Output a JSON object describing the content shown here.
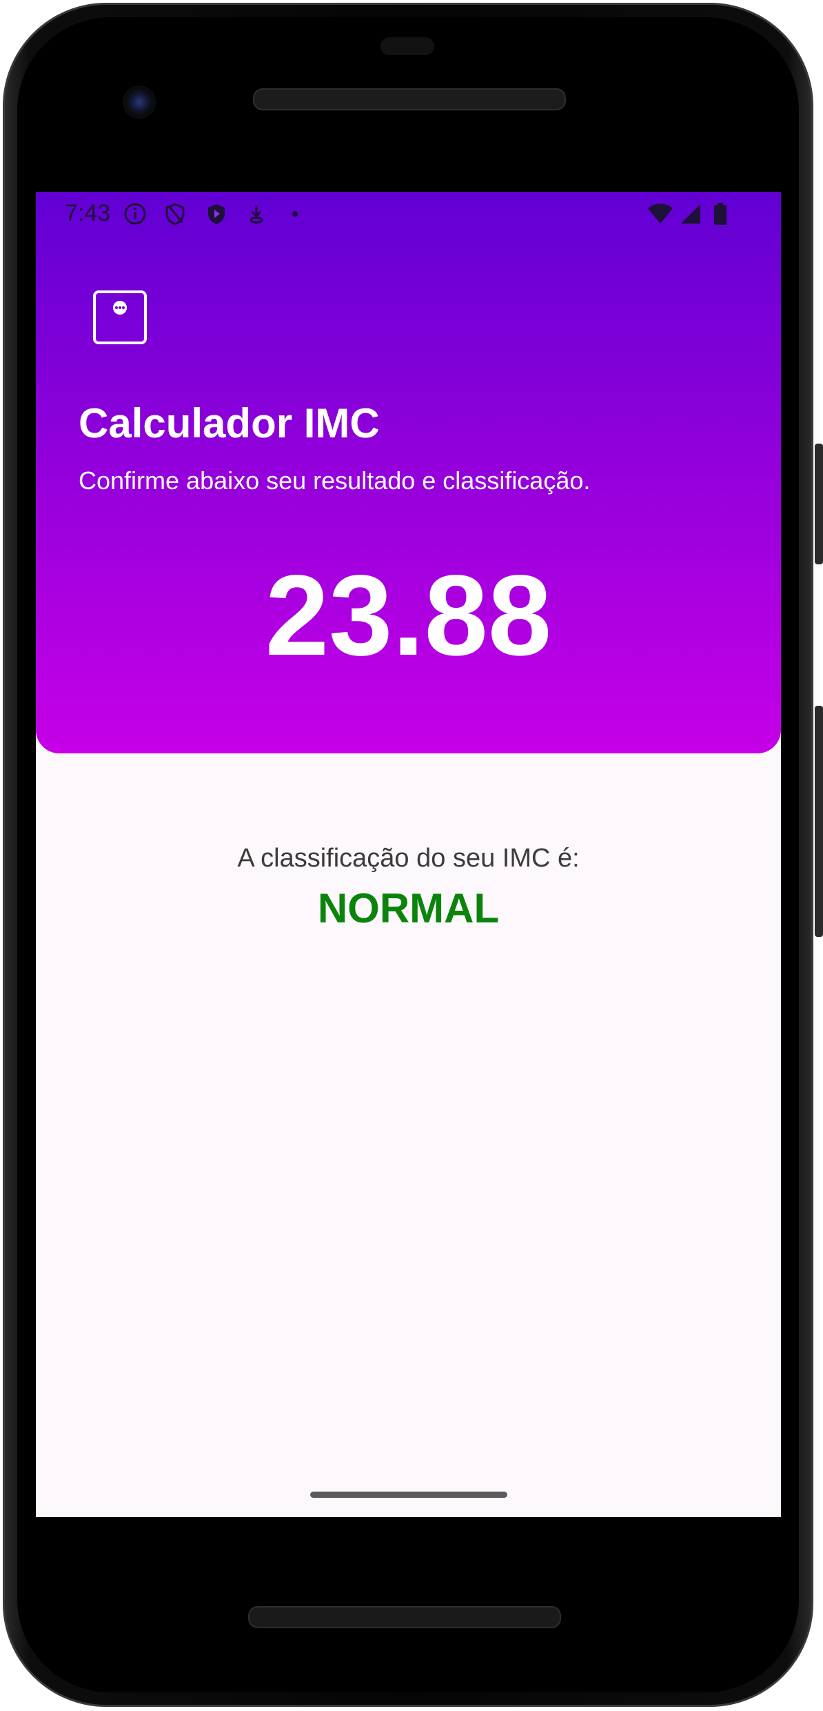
{
  "status_bar": {
    "time": "7:43",
    "left_icons": [
      "info-icon",
      "vpn-shield-icon",
      "play-protect-icon",
      "download-icon",
      "dot-icon"
    ],
    "right_icons": [
      "wifi-icon",
      "cell-signal-icon",
      "battery-icon"
    ]
  },
  "header": {
    "menu_icon": "dots-box-icon",
    "title": "Calculador IMC",
    "subtitle": "Confirme abaixo seu resultado e classificação.",
    "bmi_value": "23.88",
    "gradient_top": "#6100d3",
    "gradient_bottom": "#c600e6"
  },
  "result": {
    "label": "A classificação do seu IMC é:",
    "classification": "NORMAL",
    "classification_color": "#0c840c"
  }
}
